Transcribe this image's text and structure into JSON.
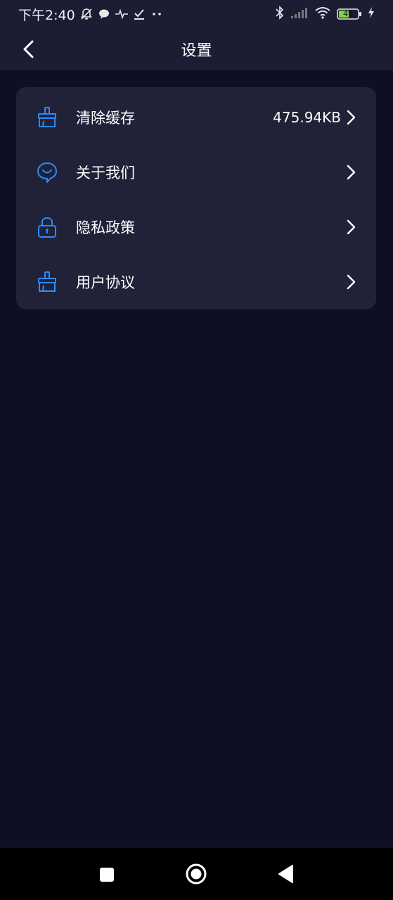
{
  "status_bar": {
    "time": "下午2:40",
    "battery_level": "49"
  },
  "header": {
    "title": "设置"
  },
  "settings": {
    "items": [
      {
        "label": "清除缓存",
        "value": "475.94KB",
        "icon": "broom-icon"
      },
      {
        "label": "关于我们",
        "value": "",
        "icon": "smile-chat-icon"
      },
      {
        "label": "隐私政策",
        "value": "",
        "icon": "lock-icon"
      },
      {
        "label": "用户协议",
        "value": "",
        "icon": "broom-icon"
      }
    ]
  },
  "colors": {
    "background": "#0e0f24",
    "panel": "#1c1d33",
    "card": "#212238",
    "accent_icon": "#2a8cff",
    "text": "#ffffff",
    "battery_fill": "#7bd83f"
  }
}
